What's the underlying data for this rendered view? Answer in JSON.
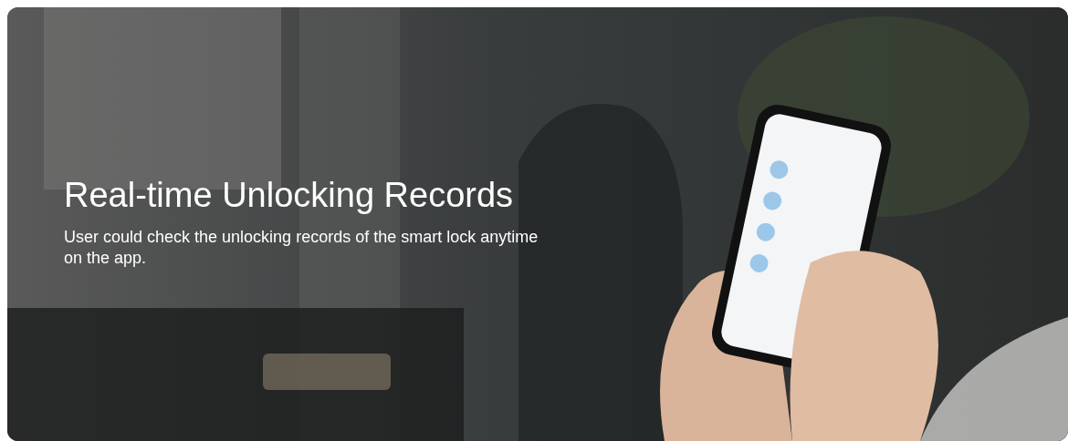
{
  "banner": {
    "kind": "picture",
    "title": "Real-time Unlocking Records",
    "description": "User could check the unlocking records of the smart lock anytime on the app."
  }
}
